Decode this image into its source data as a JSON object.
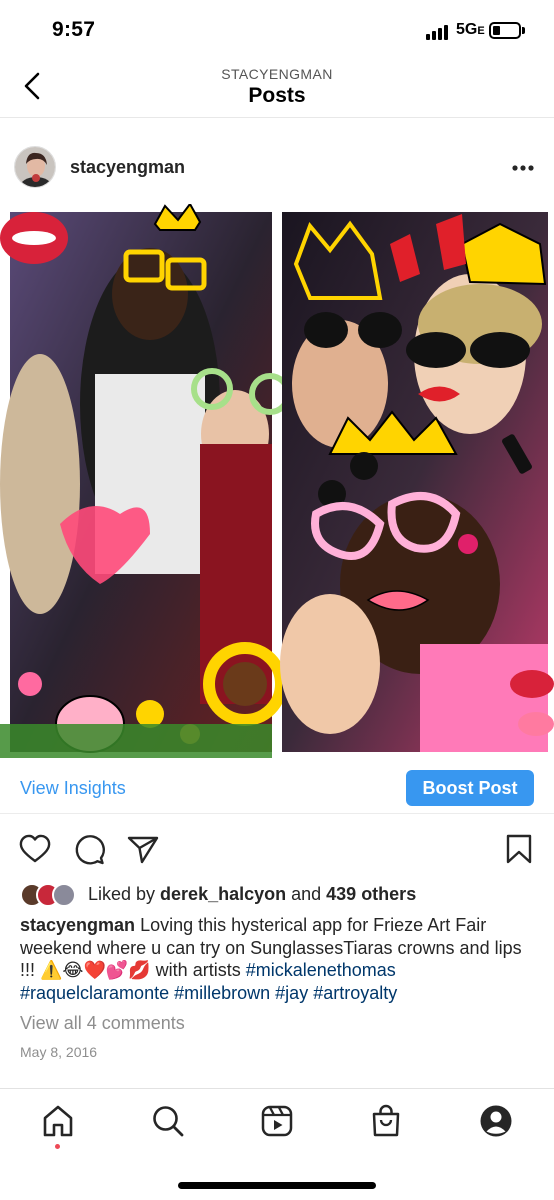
{
  "status_bar": {
    "time": "9:57",
    "network": "5G",
    "network_suffix": "E"
  },
  "header": {
    "subtitle": "STACYENGMAN",
    "title": "Posts"
  },
  "post": {
    "username": "stacyengman",
    "view_insights_label": "View Insights",
    "boost_label": "Boost Post",
    "likes": {
      "prefix": "Liked by ",
      "user": "derek_halcyon",
      "middle": " and ",
      "others": "439 others"
    },
    "caption": {
      "user": "stacyengman",
      "text": " Loving this hysterical app for Frieze Art Fair weekend where u can try on SunglassesTiaras crowns and lips !!! ⚠️😂❤️💕💋 with artists ",
      "tags": [
        "#mickalenethomas",
        "#raquelclaramonte",
        "#millebrown",
        "#jay",
        "#artroyalty"
      ]
    },
    "view_comments": "View all 4 comments",
    "date": "May 8, 2016"
  },
  "colors": {
    "accent": "#3897f0",
    "hashtag": "#00376b",
    "muted": "#8e8e8e",
    "notification_dot": "#ed4956"
  },
  "icons": {
    "back": "chevron-left-icon",
    "more": "ellipsis-icon",
    "like": "heart-icon",
    "comment": "comment-icon",
    "share": "paper-plane-icon",
    "save": "bookmark-icon",
    "nav": [
      "home-icon",
      "search-icon",
      "reels-icon",
      "shop-icon",
      "profile-icon"
    ]
  }
}
